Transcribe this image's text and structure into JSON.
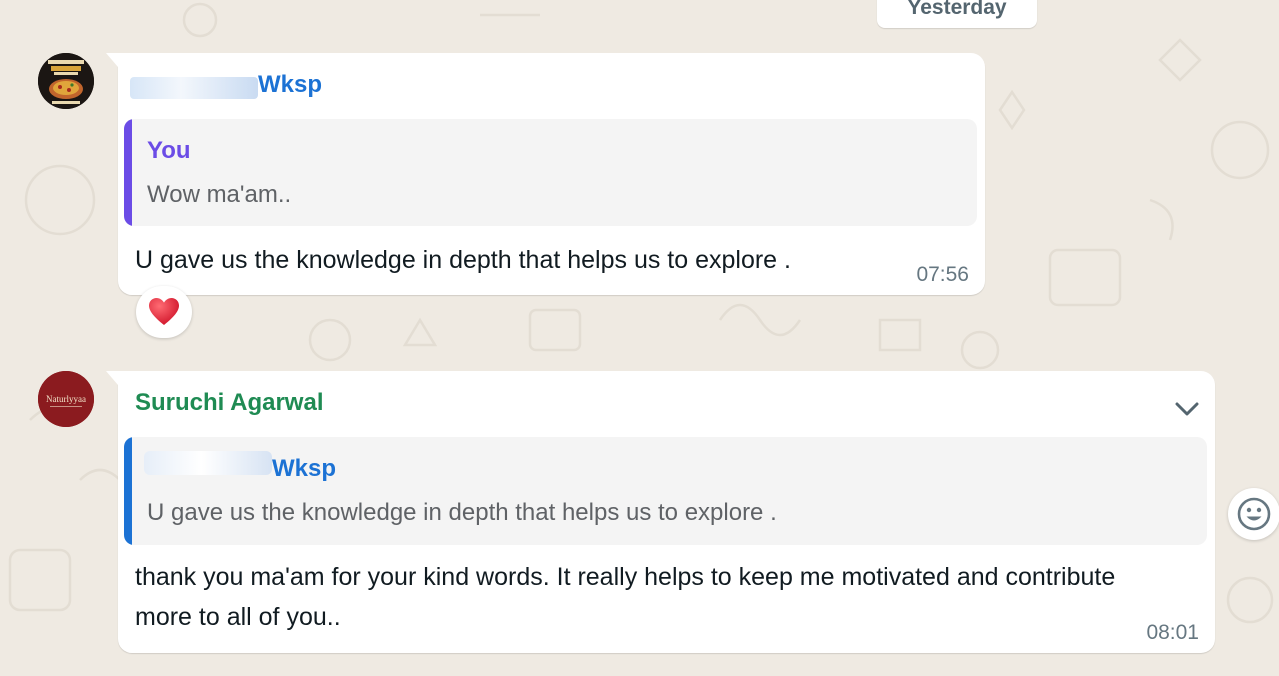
{
  "date_separator": "Yesterday",
  "messages": [
    {
      "sender": "Wksp",
      "quoted": {
        "author": "You",
        "text": "Wow ma'am.."
      },
      "text": "U gave us the knowledge in depth that helps us to explore .",
      "time": "07:56",
      "reaction": "heart",
      "avatar_icon": "pizza-poster-avatar-icon"
    },
    {
      "sender": "Suruchi Agarwal",
      "quoted": {
        "author": "Wksp",
        "text": "U gave us the knowledge in depth that helps us to explore ."
      },
      "text": "thank you ma'am for your kind words. It really helps to keep me motivated and contribute more to all of you..",
      "time": "08:01",
      "avatar_text": "Naturlyyaa",
      "avatar_icon": "naturlyyaa-logo-avatar-icon"
    }
  ],
  "colors": {
    "background": "#efeae2",
    "sender_blue": "#1c72d4",
    "sender_green": "#1f8b53",
    "quote_purple": "#6b4ce6",
    "timestamp": "#667781"
  }
}
